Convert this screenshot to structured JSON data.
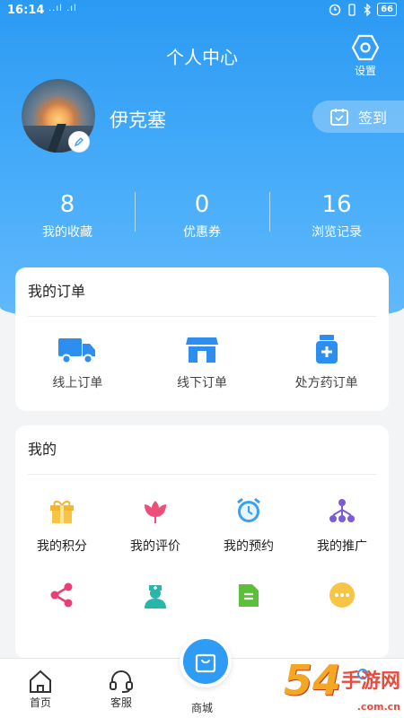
{
  "status_bar": {
    "time": "16:14",
    "signal": "..ıl .ıl",
    "battery": "66"
  },
  "header": {
    "title": "个人中心",
    "settings_label": "设置"
  },
  "user": {
    "name": "伊克塞",
    "checkin_label": "签到"
  },
  "stats": [
    {
      "value": "8",
      "label": "我的收藏"
    },
    {
      "value": "0",
      "label": "优惠券"
    },
    {
      "value": "16",
      "label": "浏览记录"
    }
  ],
  "orders": {
    "title": "我的订单",
    "items": [
      {
        "label": "线上订单",
        "icon": "truck-icon"
      },
      {
        "label": "线下订单",
        "icon": "store-icon"
      },
      {
        "label": "处方药订单",
        "icon": "medicine-bottle-icon"
      }
    ]
  },
  "mine": {
    "title": "我的",
    "items": [
      {
        "label": "我的积分",
        "icon": "gift-icon"
      },
      {
        "label": "我的评价",
        "icon": "flower-icon"
      },
      {
        "label": "我的预约",
        "icon": "alarm-clock-icon"
      },
      {
        "label": "我的推广",
        "icon": "network-icon"
      },
      {
        "label": "",
        "icon": "share-icon"
      },
      {
        "label": "",
        "icon": "nurse-icon"
      },
      {
        "label": "",
        "icon": "document-icon"
      },
      {
        "label": "",
        "icon": "more-icon"
      }
    ]
  },
  "tabbar": {
    "items": [
      {
        "label": "首页",
        "icon": "home-icon"
      },
      {
        "label": "客服",
        "icon": "headset-icon"
      },
      {
        "label": "商城",
        "icon": "shopping-bag-icon"
      }
    ]
  },
  "watermark": {
    "number": "54",
    "text": "手游网",
    "url": ".com.cn"
  },
  "colors": {
    "primary": "#2e9bf4",
    "background": "#f3f4f6"
  }
}
